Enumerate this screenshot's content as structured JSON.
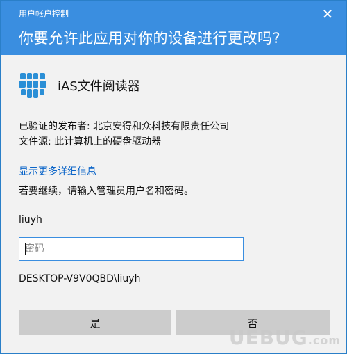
{
  "window": {
    "caption": "用户帐户控制",
    "close_glyph": "✕"
  },
  "header": {
    "question": "你要允许此应用对你的设备进行更改吗?"
  },
  "app": {
    "name": "iAS文件阅读器",
    "icon": "ias-app-icon",
    "icon_color": "#2b8fd6"
  },
  "info": {
    "publisher": "已验证的发布者: 北京安得和众科技有限责任公司",
    "file_source": "文件源: 此计算机上的硬盘驱动器"
  },
  "details_link": "显示更多详细信息",
  "prompt": "若要继续，请输入管理员用户名和密码。",
  "credentials": {
    "username": "liuyh",
    "password_placeholder": "密码",
    "password_value": "",
    "domain_user": "DESKTOP-V9V0QBD\\liuyh"
  },
  "buttons": {
    "yes": "是",
    "no": "否"
  },
  "watermark": {
    "text": "UEBUG",
    "suffix": ".com"
  },
  "colors": {
    "header_bg": "#3a8ee0",
    "link": "#0a64c8",
    "button_bg": "#cccccc"
  }
}
